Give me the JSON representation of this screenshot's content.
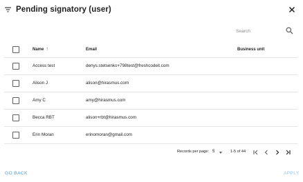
{
  "dialog": {
    "title": "Pending signatory (user)"
  },
  "search": {
    "placeholder": "Search"
  },
  "table": {
    "columns": {
      "name": "Name",
      "email": "Email",
      "business_unit": "Business unit"
    },
    "rows": [
      {
        "name": "Access test",
        "email": "denys.stetsenko+798test@freshcodeit.com",
        "business_unit": ""
      },
      {
        "name": "Alison J",
        "email": "alison@hirasmus.com",
        "business_unit": ""
      },
      {
        "name": "Amy C",
        "email": "amy@hirasmus.com",
        "business_unit": ""
      },
      {
        "name": "Becca RBT",
        "email": "alison+rbt@hirasmus.com",
        "business_unit": ""
      },
      {
        "name": "Erin Moran",
        "email": "erinomoran@gmail.com",
        "business_unit": ""
      }
    ]
  },
  "pagination": {
    "records_label": "Records per page:",
    "records_per_page": "5",
    "range": "1-5 of 44"
  },
  "footer": {
    "go_back": "GO BACK",
    "apply": "APPLY"
  },
  "colors": {
    "link": "#4a9fde",
    "disabled_link": "#8ec4ee"
  },
  "icons": [
    "filter-icon",
    "close-icon",
    "search-icon",
    "arrow-up-icon",
    "first-page-icon",
    "prev-page-icon",
    "next-page-icon",
    "last-page-icon",
    "chevron-down-icon"
  ]
}
